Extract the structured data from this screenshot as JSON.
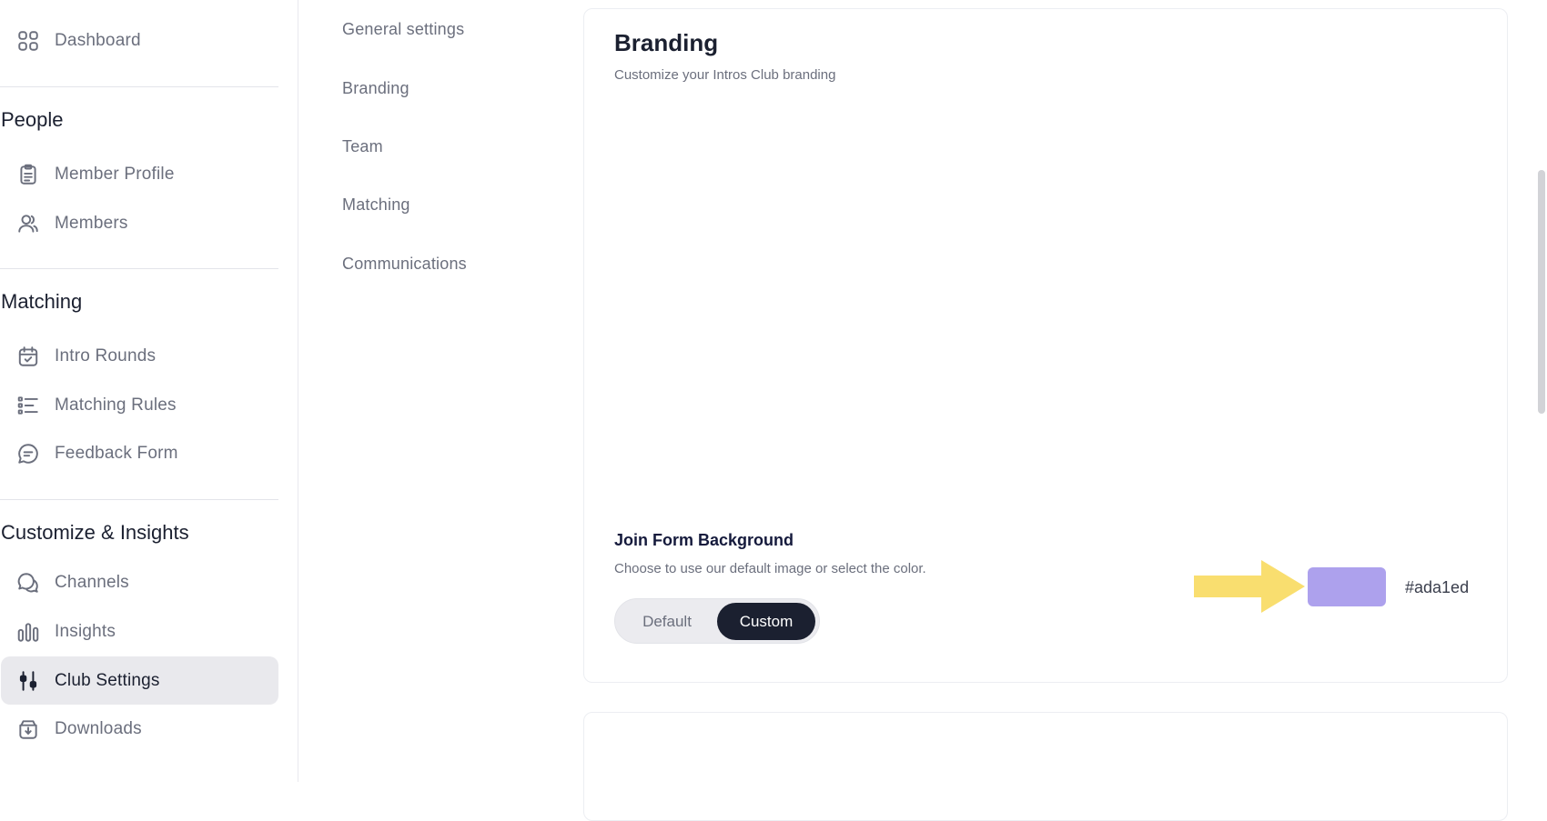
{
  "sidebar": {
    "dashboard": {
      "label": "Dashboard",
      "icon": "grid-icon"
    },
    "sections": [
      {
        "title": "People"
      },
      {
        "title": "Matching"
      },
      {
        "title": "Customize & Insights"
      }
    ],
    "items": [
      {
        "label": "Member Profile",
        "icon": "clipboard-icon"
      },
      {
        "label": "Members",
        "icon": "users-icon"
      },
      {
        "label": "Intro Rounds",
        "icon": "calendar-check-icon"
      },
      {
        "label": "Matching Rules",
        "icon": "list-icon"
      },
      {
        "label": "Feedback Form",
        "icon": "message-icon"
      },
      {
        "label": "Channels",
        "icon": "chat-bubbles-icon"
      },
      {
        "label": "Insights",
        "icon": "bar-chart-icon"
      },
      {
        "label": "Club Settings",
        "icon": "sliders-icon",
        "active": true
      },
      {
        "label": "Downloads",
        "icon": "download-box-icon"
      }
    ]
  },
  "subnav": {
    "items": [
      {
        "label": "General settings"
      },
      {
        "label": "Branding"
      },
      {
        "label": "Team"
      },
      {
        "label": "Matching"
      },
      {
        "label": "Communications"
      }
    ]
  },
  "branding": {
    "title": "Branding",
    "subtitle": "Customize your Intros Club branding",
    "join_form": {
      "title": "Join Form Background",
      "subtitle": "Choose to use our default image or select the color.",
      "options": {
        "default": "Default",
        "custom": "Custom"
      },
      "selected": "Custom",
      "color": "#ada1ed",
      "hex_label": "#ada1ed"
    }
  },
  "colors": {
    "accent_dark": "#1b2030",
    "arrow": "#f9de6f",
    "swatch": "#ada1ed"
  }
}
